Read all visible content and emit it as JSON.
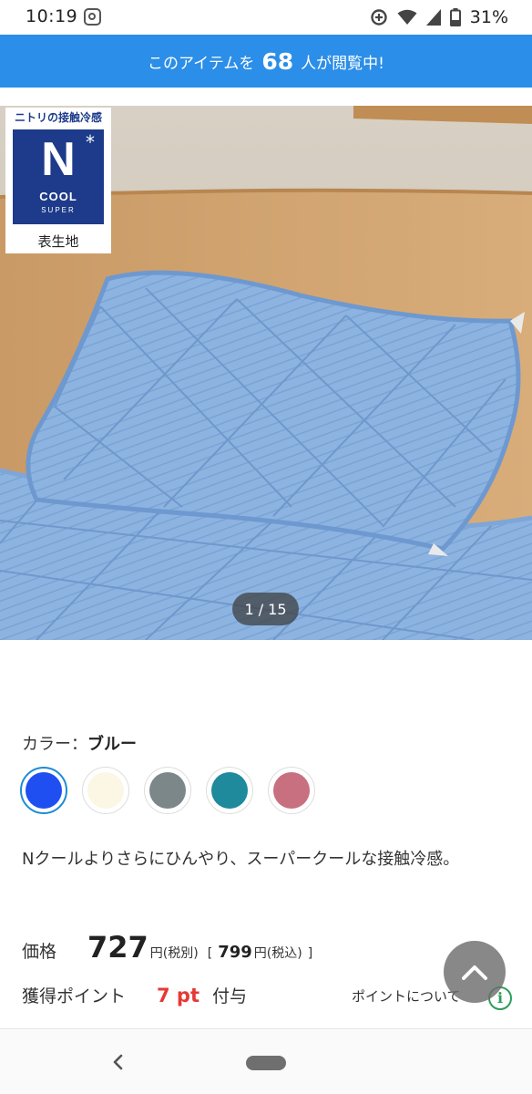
{
  "status_bar": {
    "time": "10:19",
    "battery": "31%",
    "icons": [
      "instagram-icon",
      "data-saver-icon",
      "wifi-icon",
      "signal-icon",
      "battery-icon"
    ]
  },
  "banner": {
    "prefix": "このアイテムを",
    "count": "68",
    "suffix": "人が閲覧中!",
    "color": "#2b8ee8"
  },
  "gallery": {
    "badge_title": "ニトリの接触冷感",
    "badge_logo_letter": "N",
    "badge_logo_star": "*",
    "badge_logo_cool": "COOL",
    "badge_logo_super": "SUPER",
    "badge_caption": "表生地",
    "pager": "1 / 15"
  },
  "color_select": {
    "label": "カラー：",
    "selected_name": "ブルー",
    "swatches": [
      {
        "name": "blue",
        "color": "#1f4ff0",
        "selected": true
      },
      {
        "name": "ivory",
        "color": "#fbf7e4",
        "selected": false
      },
      {
        "name": "gray",
        "color": "#7b8789",
        "selected": false
      },
      {
        "name": "teal",
        "color": "#1e8a9c",
        "selected": false
      },
      {
        "name": "pink",
        "color": "#c86f80",
        "selected": false
      }
    ]
  },
  "description": "Nクールよりさらにひんやり、スーパークールな接触冷感。",
  "price": {
    "label": "価格",
    "amount": "727",
    "unit": "円",
    "tax_excluded": "(税別)",
    "bracket_open": "[",
    "amount_incl": "799",
    "unit_incl": "円",
    "tax_included": "(税込)",
    "bracket_close": "]"
  },
  "points": {
    "label": "獲得ポイント",
    "value": "7 pt",
    "grant": "付与",
    "link": "ポイントについて",
    "info_glyph": "i"
  }
}
